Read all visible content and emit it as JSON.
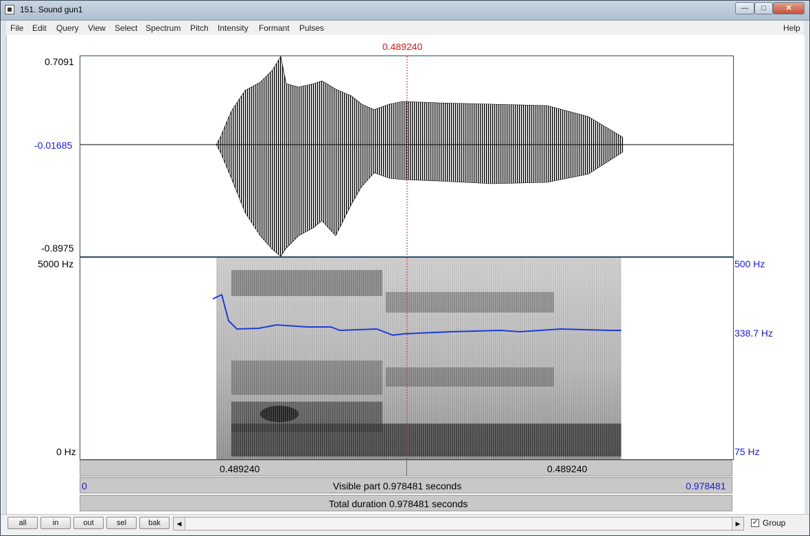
{
  "window": {
    "title": "151. Sound gun1"
  },
  "menu": [
    "File",
    "Edit",
    "Query",
    "View",
    "Select",
    "Spectrum",
    "Pitch",
    "Intensity",
    "Formant",
    "Pulses"
  ],
  "help": "Help",
  "cursor": {
    "time_label": "0.489240"
  },
  "waveform": {
    "ymax": "0.7091",
    "ymid": "-0.01685",
    "ymin": "-0.8975"
  },
  "spectrogram": {
    "fmax": "5000 Hz",
    "fmin": "0 Hz"
  },
  "pitch": {
    "max": "500 Hz",
    "current": "338.7 Hz",
    "min": "75 Hz"
  },
  "time_bar": {
    "left_segment": "0.489240",
    "right_segment": "0.489240"
  },
  "visible_bar": {
    "start": "0",
    "label": "Visible part 0.978481 seconds",
    "end": "0.978481"
  },
  "total_bar": {
    "label": "Total duration 0.978481 seconds"
  },
  "buttons": [
    "all",
    "in",
    "out",
    "sel",
    "bak"
  ],
  "group": {
    "label": "Group",
    "checked": true
  },
  "colors": {
    "cursor": "#d21e1e",
    "pitch_track": "#1a3cd8",
    "axis_blue": "#1a1adb"
  }
}
